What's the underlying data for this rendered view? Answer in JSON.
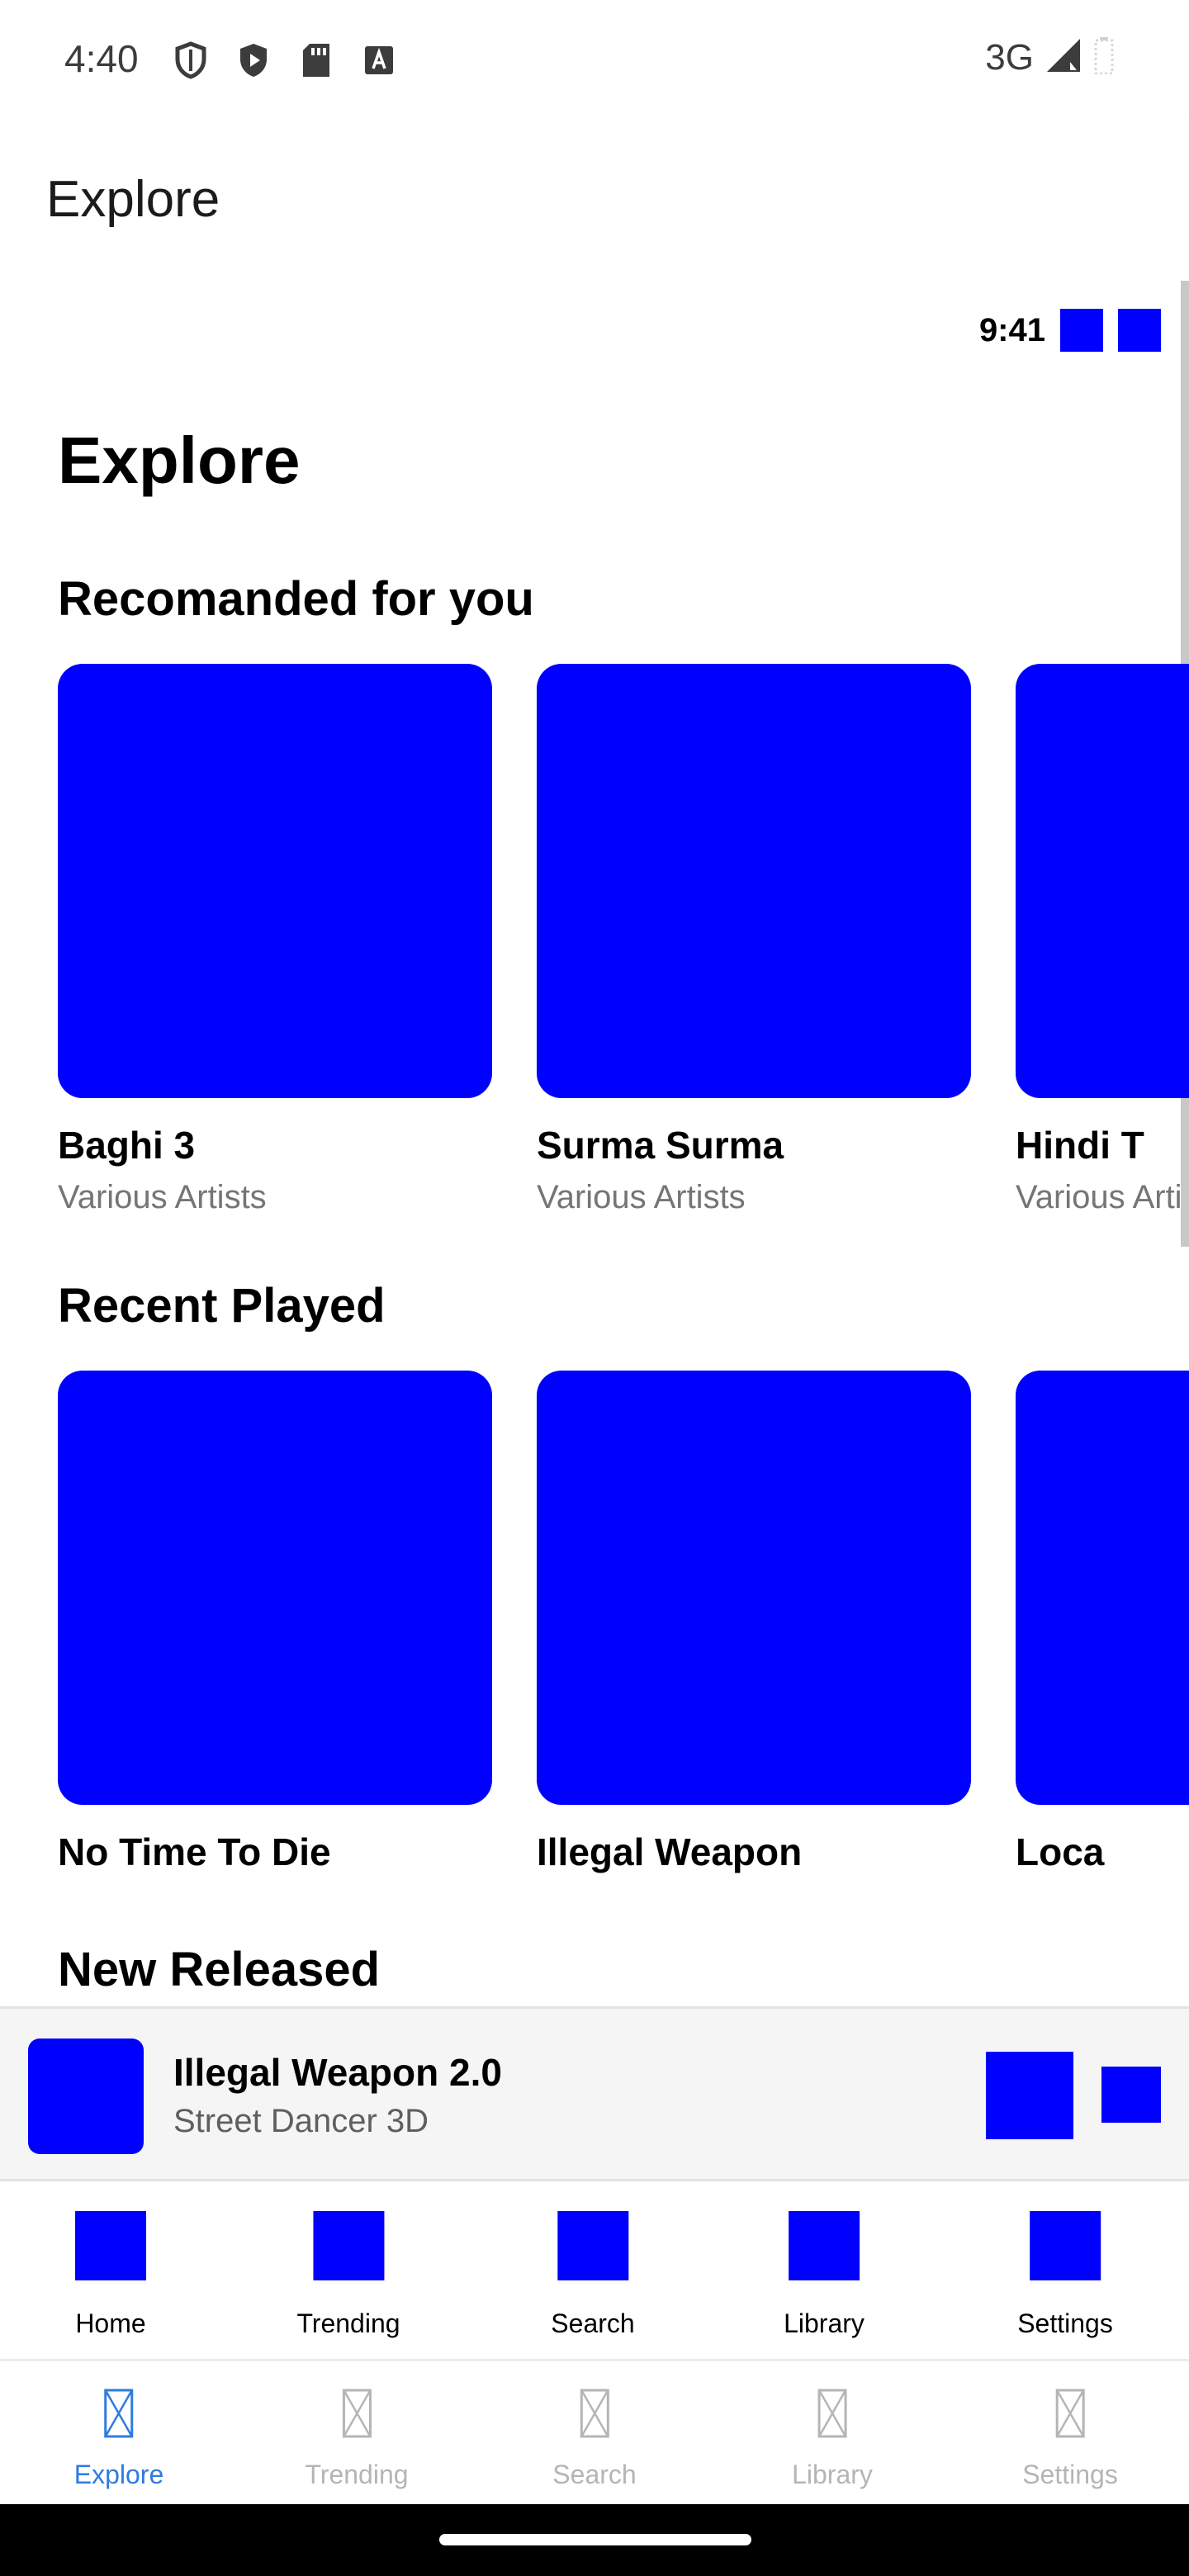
{
  "status_bar": {
    "time": "4:40",
    "network": "3G",
    "icons": [
      "shield-outline-icon",
      "shield-play-icon",
      "sd-card-icon",
      "font-a-icon"
    ]
  },
  "app_bar": {
    "title": "Explore"
  },
  "inner": {
    "status_time": "9:41",
    "page_title": "Explore",
    "sections": {
      "recommended": {
        "title": "Recomanded for you",
        "items": [
          {
            "title": "Baghi 3",
            "subtitle": "Various Artists"
          },
          {
            "title": "Surma Surma",
            "subtitle": "Various Artists"
          },
          {
            "title": "Hindi T",
            "subtitle": "Various Arti"
          }
        ]
      },
      "recent": {
        "title": "Recent Played",
        "items": [
          {
            "title": "No Time To Die"
          },
          {
            "title": "Illegal Weapon"
          },
          {
            "title": "Loca"
          }
        ]
      },
      "new_released": {
        "title": "New Released"
      }
    },
    "mini_player": {
      "title": "Illegal Weapon 2.0",
      "subtitle": "Street Dancer 3D"
    },
    "bottom_nav": [
      "Home",
      "Trending",
      "Search",
      "Library",
      "Settings"
    ]
  },
  "outer_nav": {
    "items": [
      "Explore",
      "Trending",
      "Search",
      "Library",
      "Settings"
    ],
    "active": "Explore"
  },
  "colors": {
    "placeholder_blue": "#0000ff",
    "active_tab": "#2f7be0",
    "inactive_tab": "#b5b5b5"
  }
}
